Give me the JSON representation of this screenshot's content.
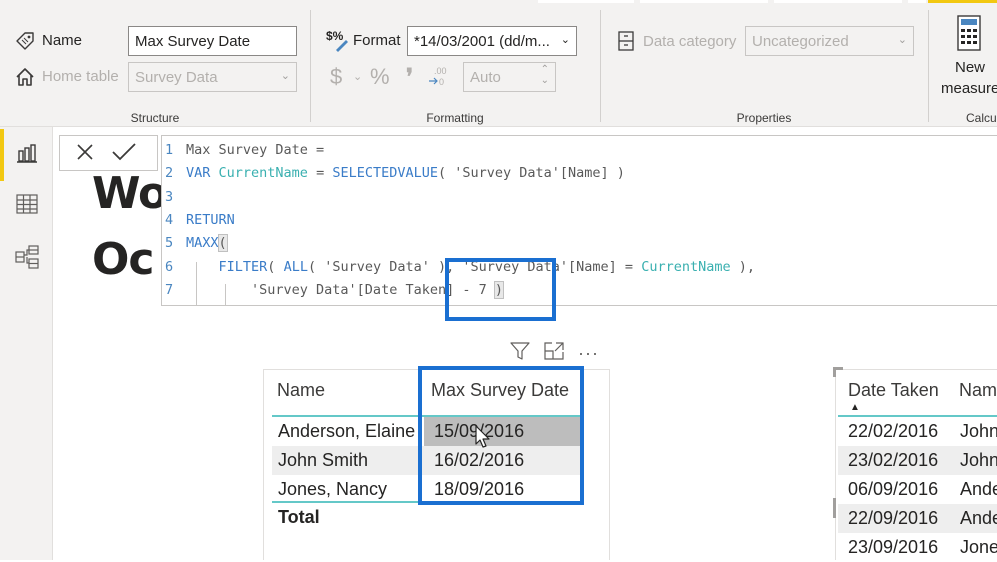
{
  "ribbon": {
    "structure": {
      "name_label": "Name",
      "name_value": "Max Survey Date",
      "home_table_label": "Home table",
      "home_table_value": "Survey Data",
      "group_label": "Structure"
    },
    "formatting": {
      "format_label": "Format",
      "format_value": "*14/03/2001 (dd/m...",
      "currency_symbol": "$",
      "percent_symbol": "%",
      "comma_symbol": "❜",
      "decimal_top": ".00",
      "decimal_bottom": "→0",
      "decimals_value": "Auto",
      "group_label": "Formatting"
    },
    "properties": {
      "data_category_label": "Data category",
      "data_category_value": "Uncategorized",
      "group_label": "Properties"
    },
    "calculations": {
      "new_measure_line1": "New",
      "new_measure_line2": "measure",
      "group_label": "Calcu"
    }
  },
  "leftnav": {
    "items": [
      {
        "name": "report-view",
        "icon": "bar-chart-icon",
        "active": true
      },
      {
        "name": "data-view",
        "icon": "table-icon",
        "active": false
      },
      {
        "name": "model-view",
        "icon": "model-icon",
        "active": false
      }
    ]
  },
  "canvas": {
    "title_line1": "Wo",
    "title_line2": "Oc"
  },
  "formula_bar": {
    "cancel_icon": "✕",
    "commit_icon": "✓",
    "lines": [
      {
        "num": "1",
        "tokens": [
          {
            "t": "Max Survey Date =",
            "c": "plain"
          }
        ]
      },
      {
        "num": "2",
        "tokens": [
          {
            "t": "VAR",
            "c": "kw"
          },
          {
            "t": " ",
            "c": "plain"
          },
          {
            "t": "CurrentName",
            "c": "var"
          },
          {
            "t": " = ",
            "c": "plain"
          },
          {
            "t": "SELECTEDVALUE",
            "c": "kw"
          },
          {
            "t": "( 'Survey Data'[Name] )",
            "c": "plain"
          }
        ]
      },
      {
        "num": "3",
        "tokens": []
      },
      {
        "num": "4",
        "tokens": [
          {
            "t": "RETURN",
            "c": "kw"
          }
        ]
      },
      {
        "num": "5",
        "tokens": [
          {
            "t": "MAXX",
            "c": "kw"
          },
          {
            "t": "(",
            "c": "paren"
          }
        ]
      },
      {
        "num": "6",
        "tokens": [
          {
            "t": "    ",
            "c": "plain"
          },
          {
            "t": "FILTER",
            "c": "kw"
          },
          {
            "t": "( ",
            "c": "plain"
          },
          {
            "t": "ALL",
            "c": "kw"
          },
          {
            "t": "( 'Survey Data' ), 'Survey Data'[Name] = ",
            "c": "plain"
          },
          {
            "t": "CurrentName",
            "c": "var"
          },
          {
            "t": " ),",
            "c": "plain"
          }
        ]
      },
      {
        "num": "7",
        "tokens": [
          {
            "t": "        'Survey Data'[Date Taken] - 7 ",
            "c": "plain"
          },
          {
            "t": ")",
            "c": "paren"
          }
        ]
      }
    ]
  },
  "visual1": {
    "headers": [
      "Name",
      "Max Survey Date"
    ],
    "rows": [
      {
        "name": "Anderson, Elaine",
        "date": "15/09/2016",
        "selected": true
      },
      {
        "name": "John Smith",
        "date": "16/02/2016",
        "selected": false
      },
      {
        "name": "Jones, Nancy",
        "date": "18/09/2016",
        "selected": false
      }
    ],
    "total_label": "Total",
    "header_icons": [
      "filter-icon",
      "focus-mode-icon",
      "more-options-icon"
    ]
  },
  "visual2": {
    "headers": [
      "Date Taken",
      "Name"
    ],
    "sort_indicator": "▲",
    "rows": [
      {
        "date": "22/02/2016",
        "name": "John"
      },
      {
        "date": "23/02/2016",
        "name": "John"
      },
      {
        "date": "06/09/2016",
        "name": "Ande"
      },
      {
        "date": "22/09/2016",
        "name": "Ande"
      },
      {
        "date": "23/09/2016",
        "name": "Jone"
      }
    ]
  },
  "colors": {
    "accent_yellow": "#f2c811",
    "highlight_blue": "#1a6fd1",
    "keyword_blue": "#3a7cc8",
    "variable_teal": "#3ab0b0",
    "table_teal": "#64c8c8"
  }
}
